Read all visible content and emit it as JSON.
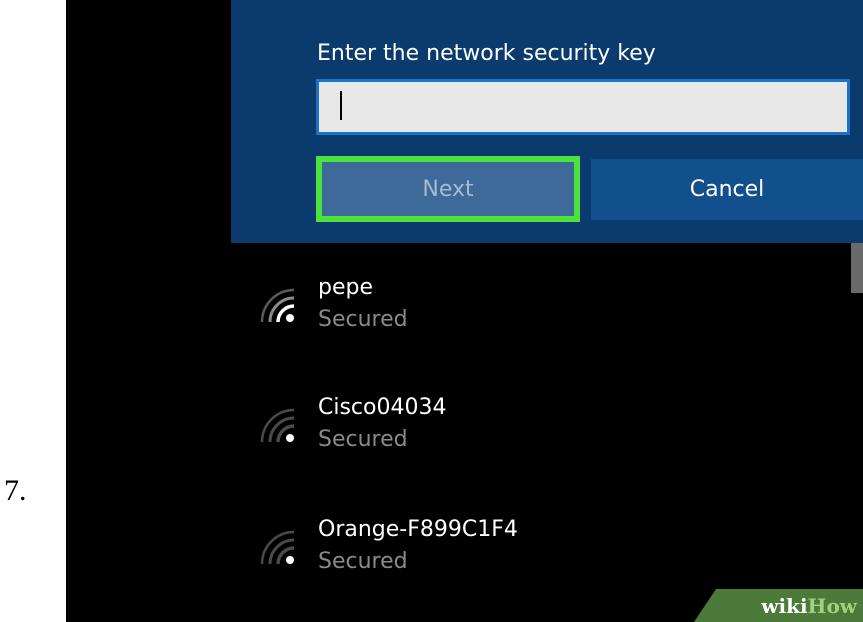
{
  "step": {
    "number": "7."
  },
  "dialog": {
    "prompt": "Enter the network security key",
    "key_input": {
      "value": "",
      "placeholder": ""
    },
    "next_label": "Next",
    "cancel_label": "Cancel"
  },
  "networks": [
    {
      "name": "pepe",
      "status": "Secured",
      "icon": "wifi-signal-icon"
    },
    {
      "name": "Cisco04034",
      "status": "Secured",
      "icon": "wifi-signal-icon"
    },
    {
      "name": "Orange-F899C1F4",
      "status": "Secured",
      "icon": "wifi-signal-icon"
    }
  ],
  "watermark": {
    "wiki": "wiki",
    "how": "How"
  },
  "colors": {
    "dialog_bg": "#0b3a6c",
    "highlight": "#4be33c",
    "input_border": "#1a73c9",
    "watermark_bg": "#4c7a3a"
  }
}
